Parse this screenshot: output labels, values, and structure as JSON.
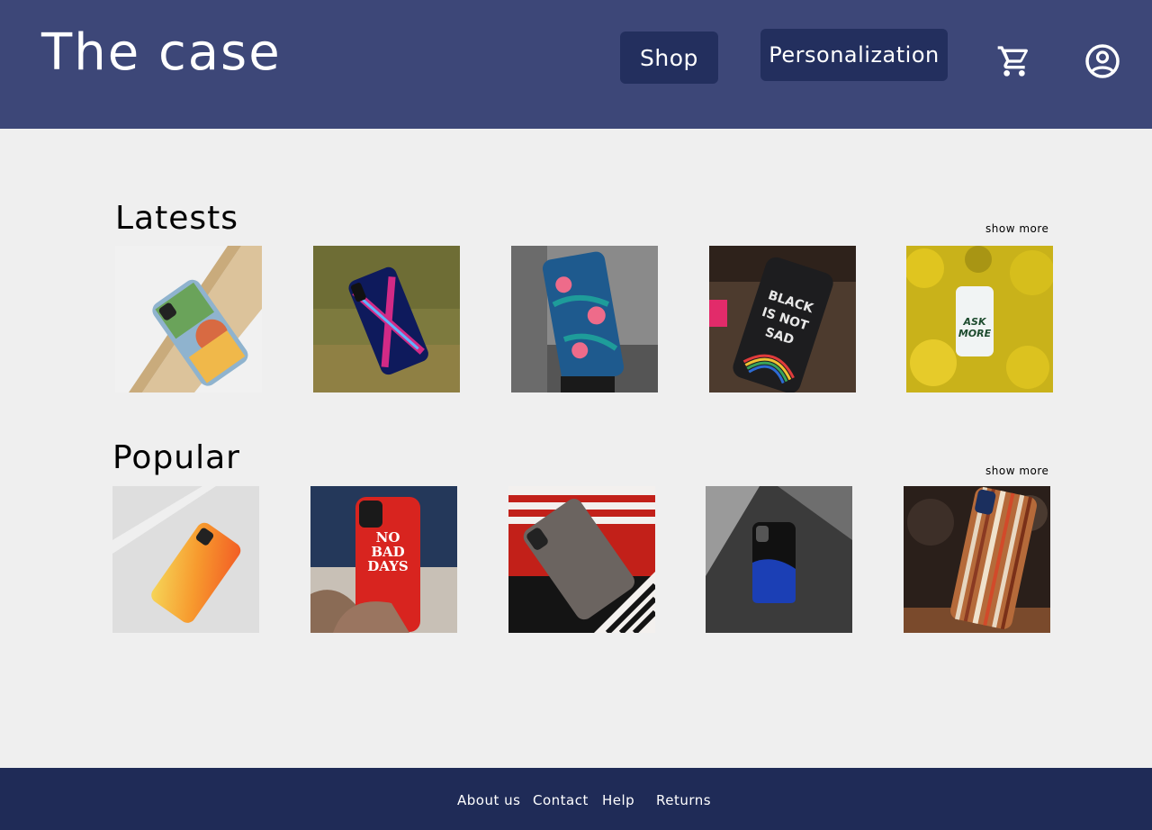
{
  "header": {
    "logo": "The case",
    "nav": {
      "shop": "Shop",
      "personalization": "Personalization"
    },
    "icons": {
      "cart": "cart-icon",
      "account": "account-circle-icon"
    },
    "colors": {
      "bar": "#3d4778",
      "button": "#232f5e"
    }
  },
  "sections": {
    "latests": {
      "title": "Latests",
      "show_more": "show more",
      "products": [
        {
          "image": "geometric-case-photo"
        },
        {
          "image": "neon-x-case-photo"
        },
        {
          "image": "tropical-floral-case-photo"
        },
        {
          "image": "rainbow-text-case-photo",
          "text": "BLACK IS NOT SAD"
        },
        {
          "image": "yellow-leaves-case-photo",
          "text": "ASK MORE"
        }
      ]
    },
    "popular": {
      "title": "Popular",
      "show_more": "show more",
      "products": [
        {
          "image": "orange-gradient-case-photo"
        },
        {
          "image": "red-slogan-case-photo",
          "text": "NO BAD DAYS"
        },
        {
          "image": "grey-stone-case-photo"
        },
        {
          "image": "blue-marble-case-photo"
        },
        {
          "image": "wood-stripe-case-photo"
        }
      ]
    }
  },
  "footer": {
    "links": {
      "about": "About us",
      "contact": "Contact",
      "help": "Help",
      "returns": "Returns"
    },
    "color": "#1f2b57"
  }
}
